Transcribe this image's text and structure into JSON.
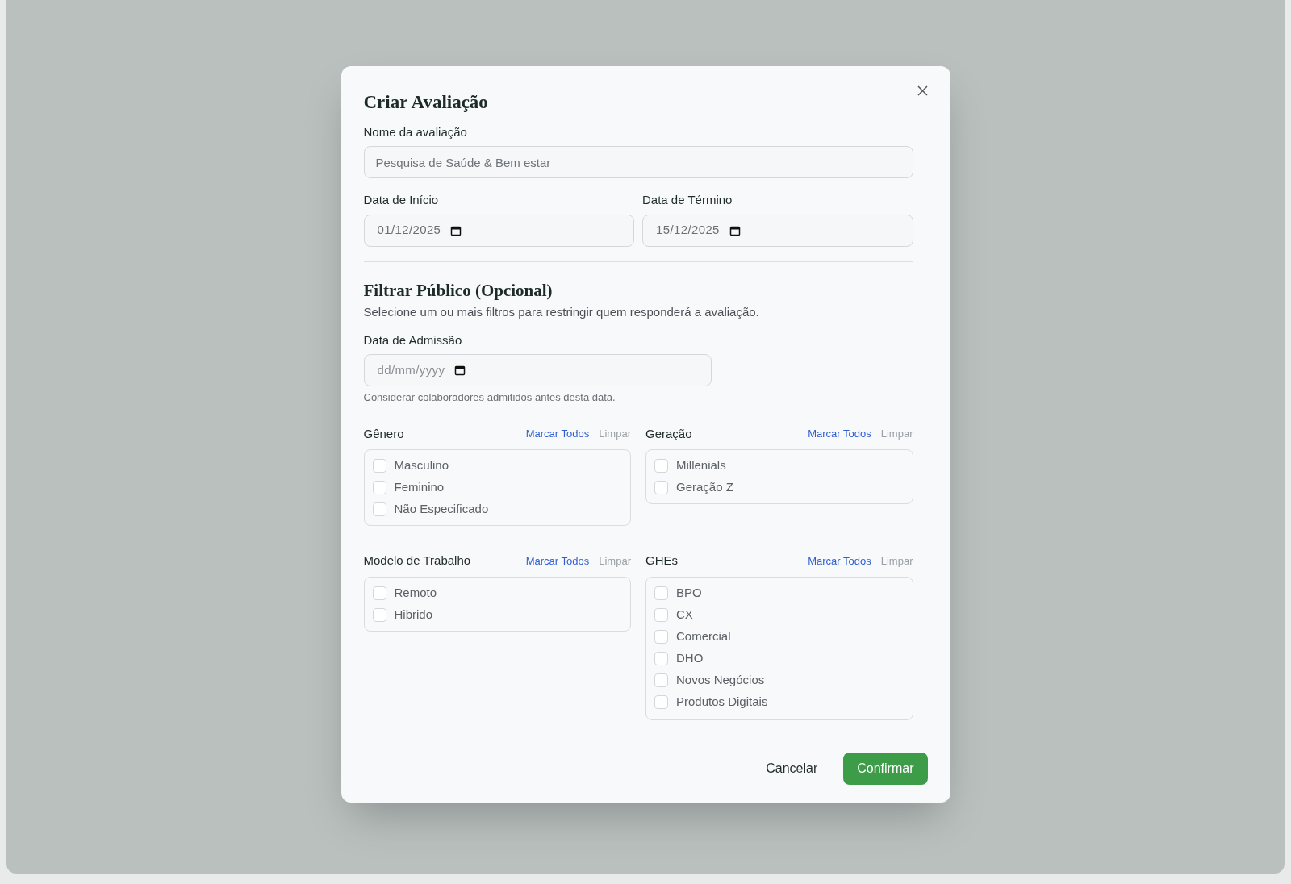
{
  "dialog": {
    "title": "Criar Avaliação",
    "name_field": {
      "label": "Nome da avaliação",
      "placeholder": "Pesquisa de Saúde & Bem estar"
    },
    "start_date": {
      "label": "Data de Início",
      "value": "01/12/2025"
    },
    "end_date": {
      "label": "Data de Término",
      "value": "15/12/2025"
    },
    "filter_section": {
      "title": "Filtrar Público (Opcional)",
      "description": "Selecione um ou mais filtros para restringir quem responderá a avaliação.",
      "admission_date": {
        "label": "Data de Admissão",
        "placeholder": "dd/mm/yyyy",
        "hint": "Considerar colaboradores admitidos antes desta data."
      },
      "groups": [
        {
          "title": "Gênero",
          "select_all": "Marcar Todos",
          "clear": "Limpar",
          "scrollable": false,
          "options": [
            {
              "label": "Masculino",
              "checked": false
            },
            {
              "label": "Feminino",
              "checked": false
            },
            {
              "label": "Não Especificado",
              "checked": false
            }
          ]
        },
        {
          "title": "Geração",
          "select_all": "Marcar Todos",
          "clear": "Limpar",
          "scrollable": false,
          "options": [
            {
              "label": "Millenials",
              "checked": false
            },
            {
              "label": "Geração Z",
              "checked": false
            }
          ]
        },
        {
          "title": "Modelo de Trabalho",
          "select_all": "Marcar Todos",
          "clear": "Limpar",
          "scrollable": false,
          "options": [
            {
              "label": "Remoto",
              "checked": false
            },
            {
              "label": "Hibrido",
              "checked": false
            }
          ]
        },
        {
          "title": "GHEs",
          "select_all": "Marcar Todos",
          "clear": "Limpar",
          "scrollable": true,
          "options": [
            {
              "label": "BPO",
              "checked": false
            },
            {
              "label": "CX",
              "checked": false
            },
            {
              "label": "Comercial",
              "checked": false
            },
            {
              "label": "DHO",
              "checked": false
            },
            {
              "label": "Novos Negócios",
              "checked": false
            },
            {
              "label": "Produtos Digitais",
              "checked": false
            }
          ]
        }
      ]
    },
    "buttons": {
      "cancel": "Cancelar",
      "confirm": "Confirmar"
    }
  }
}
